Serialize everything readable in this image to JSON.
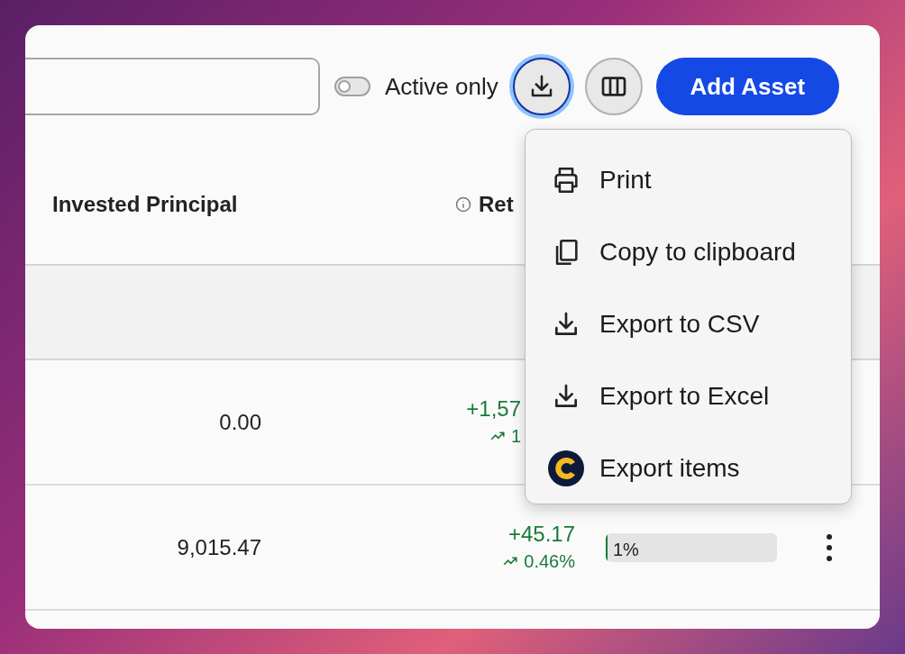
{
  "toolbar": {
    "toggle": {
      "label": "Active only",
      "on": false
    },
    "export_button": {
      "expanded": true
    },
    "add_button": {
      "label": "Add Asset"
    }
  },
  "table": {
    "columns": [
      {
        "label": "Invested Principal",
        "kind": "plain"
      },
      {
        "label": "Ret",
        "kind": "info"
      }
    ],
    "rows": [
      {
        "principal": "0.00",
        "return": "+1,57",
        "return_pct": "1"
      },
      {
        "principal": "9,015.47",
        "return": "+45.17",
        "return_pct": "0.46%",
        "share": {
          "label": "1%",
          "level": 0.01
        }
      }
    ]
  },
  "export_menu": {
    "items": [
      {
        "label": "Print",
        "kind": "print"
      },
      {
        "label": "Copy to clipboard",
        "kind": "copy"
      },
      {
        "label": "Export to CSV",
        "kind": "download"
      },
      {
        "label": "Export to Excel",
        "kind": "download"
      },
      {
        "label": "Export items",
        "kind": "logo"
      }
    ]
  }
}
